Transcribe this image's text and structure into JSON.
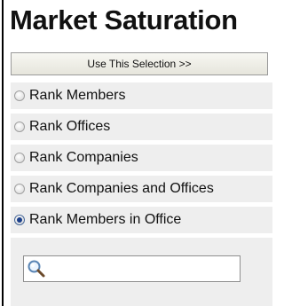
{
  "header": {
    "title": "Market Saturation"
  },
  "actions": {
    "use_selection_label": "Use This Selection >>"
  },
  "options": [
    {
      "label": "Rank Members",
      "checked": false
    },
    {
      "label": "Rank Offices",
      "checked": false
    },
    {
      "label": "Rank Companies",
      "checked": false
    },
    {
      "label": "Rank Companies and Offices",
      "checked": false
    },
    {
      "label": "Rank Members in Office",
      "checked": true
    }
  ],
  "search": {
    "value": "",
    "placeholder": "",
    "icon": "search-icon"
  }
}
